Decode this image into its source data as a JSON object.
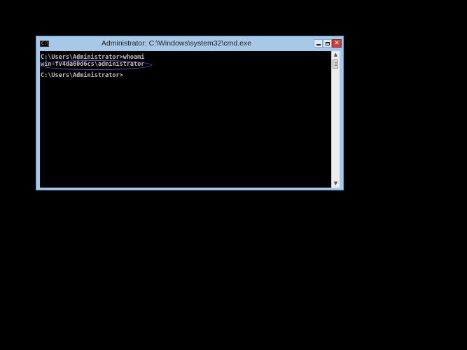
{
  "window": {
    "title": "Administrator: C:\\Windows\\system32\\cmd.exe",
    "icon": "cmd-icon",
    "icon_glyph": "C:\\",
    "controls": {
      "minimize": "minimize-icon",
      "maximize": "maximize-icon",
      "close": "close-icon",
      "close_glyph": "✕"
    }
  },
  "console": {
    "lines": [
      "C:\\Users\\Administrator>whoami",
      "win-fv4da60d6cs\\administrator",
      "",
      "C:\\Users\\Administrator>"
    ],
    "text_color": "#c0c0c0",
    "background": "#000000",
    "highlight_color": "#7a4cc4"
  },
  "scrollbar": {
    "up_arrow": "▲",
    "down_arrow": "▼"
  },
  "colors": {
    "frame": "#a8c8e8",
    "close_button": "#c8403a",
    "desktop": "#000000"
  }
}
